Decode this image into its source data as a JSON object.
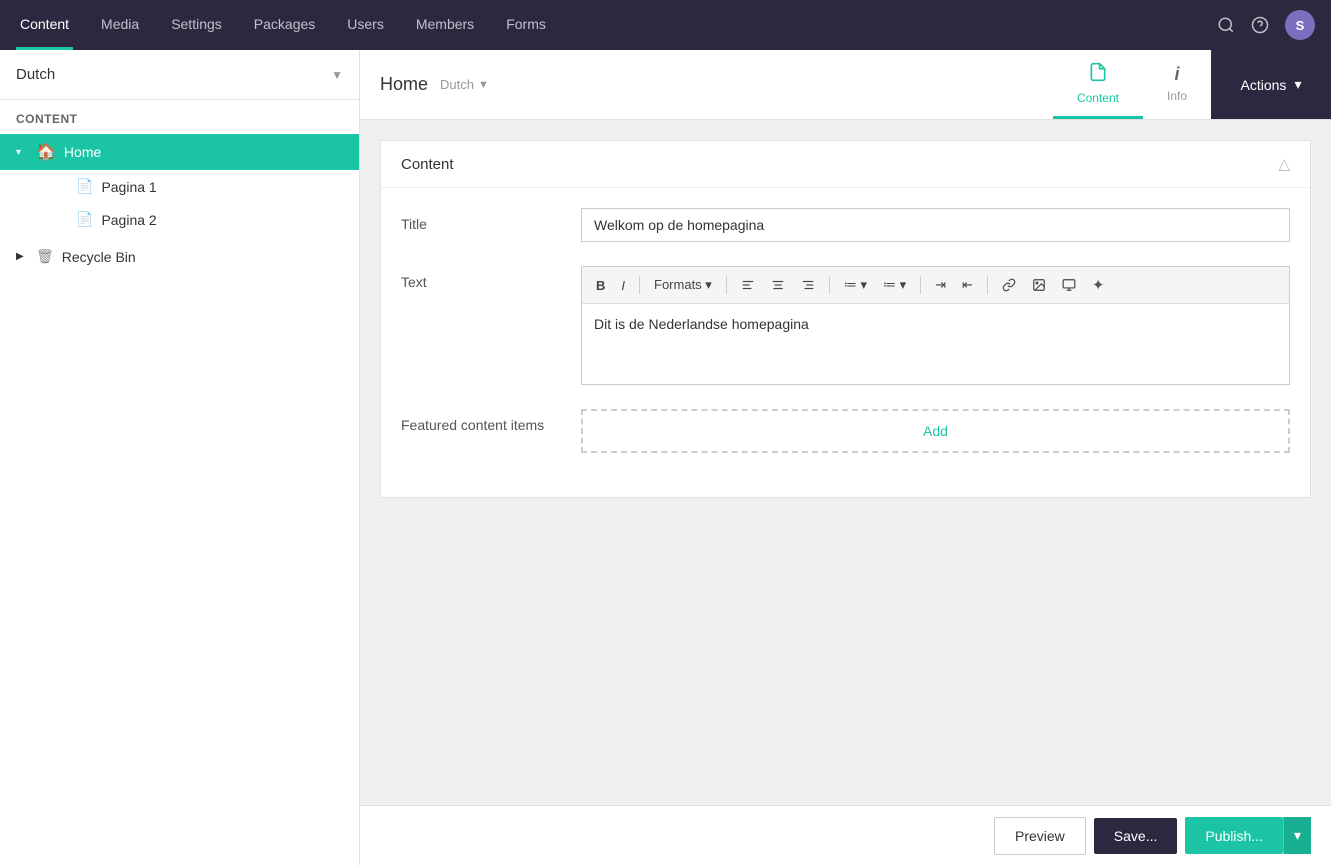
{
  "nav": {
    "items": [
      {
        "id": "content",
        "label": "Content",
        "active": true
      },
      {
        "id": "media",
        "label": "Media",
        "active": false
      },
      {
        "id": "settings",
        "label": "Settings",
        "active": false
      },
      {
        "id": "packages",
        "label": "Packages",
        "active": false
      },
      {
        "id": "users",
        "label": "Users",
        "active": false
      },
      {
        "id": "members",
        "label": "Members",
        "active": false
      },
      {
        "id": "forms",
        "label": "Forms",
        "active": false
      }
    ],
    "search_icon": "🔍",
    "help_icon": "?",
    "user_initial": "S"
  },
  "sidebar": {
    "lang_label": "Dutch",
    "lang_chevron": "▼",
    "section_label": "Content",
    "tree": [
      {
        "id": "home",
        "label": "Home",
        "icon": "🏠",
        "active": true,
        "arrow": "▾",
        "level": 0
      },
      {
        "id": "pagina1",
        "label": "Pagina 1",
        "icon": "📄",
        "active": false,
        "level": 1
      },
      {
        "id": "pagina2",
        "label": "Pagina 2",
        "icon": "📄",
        "active": false,
        "level": 1
      }
    ],
    "recycle_bin": {
      "label": "Recycle Bin",
      "icon": "🗑",
      "arrow": "▶"
    }
  },
  "header": {
    "breadcrumb": "Home",
    "lang": "Dutch",
    "lang_chevron": "▼",
    "tabs": [
      {
        "id": "content",
        "label": "Content",
        "icon": "📄",
        "active": true
      },
      {
        "id": "info",
        "label": "Info",
        "icon": "ℹ",
        "active": false
      }
    ],
    "actions_label": "Actions",
    "actions_chevron": "▾"
  },
  "content_panel": {
    "title": "Content",
    "collapse_icon": "△",
    "fields": {
      "title_label": "Title",
      "title_value": "Welkom op de homepagina",
      "title_placeholder": "Welkom op de homepagina",
      "text_label": "Text",
      "text_value": "Dit is de Nederlandse homepagina",
      "featured_label": "Featured content items",
      "add_label": "Add"
    },
    "rte_toolbar": [
      {
        "id": "bold",
        "label": "B",
        "bold": true
      },
      {
        "id": "italic",
        "label": "I",
        "italic": true
      },
      {
        "id": "formats",
        "label": "Formats ▾"
      },
      {
        "id": "sep1",
        "separator": true
      },
      {
        "id": "align-left",
        "label": "≡"
      },
      {
        "id": "align-center",
        "label": "≡"
      },
      {
        "id": "align-right",
        "label": "≡"
      },
      {
        "id": "sep2",
        "separator": true
      },
      {
        "id": "ul",
        "label": "≔ ▾"
      },
      {
        "id": "ol",
        "label": "≔ ▾"
      },
      {
        "id": "sep3",
        "separator": true
      },
      {
        "id": "indent-in",
        "label": "⇥"
      },
      {
        "id": "indent-out",
        "label": "⇤"
      },
      {
        "id": "sep4",
        "separator": true
      },
      {
        "id": "link",
        "label": "🔗"
      },
      {
        "id": "image",
        "label": "🖼"
      },
      {
        "id": "media",
        "label": "⬜"
      },
      {
        "id": "source",
        "label": "✦"
      }
    ]
  },
  "footer": {
    "preview_label": "Preview",
    "save_label": "Save...",
    "publish_label": "Publish...",
    "publish_split_label": "▾"
  },
  "colors": {
    "teal": "#1bc4a4",
    "dark_purple": "#2d2840",
    "mid_purple": "#7b6fbf"
  }
}
